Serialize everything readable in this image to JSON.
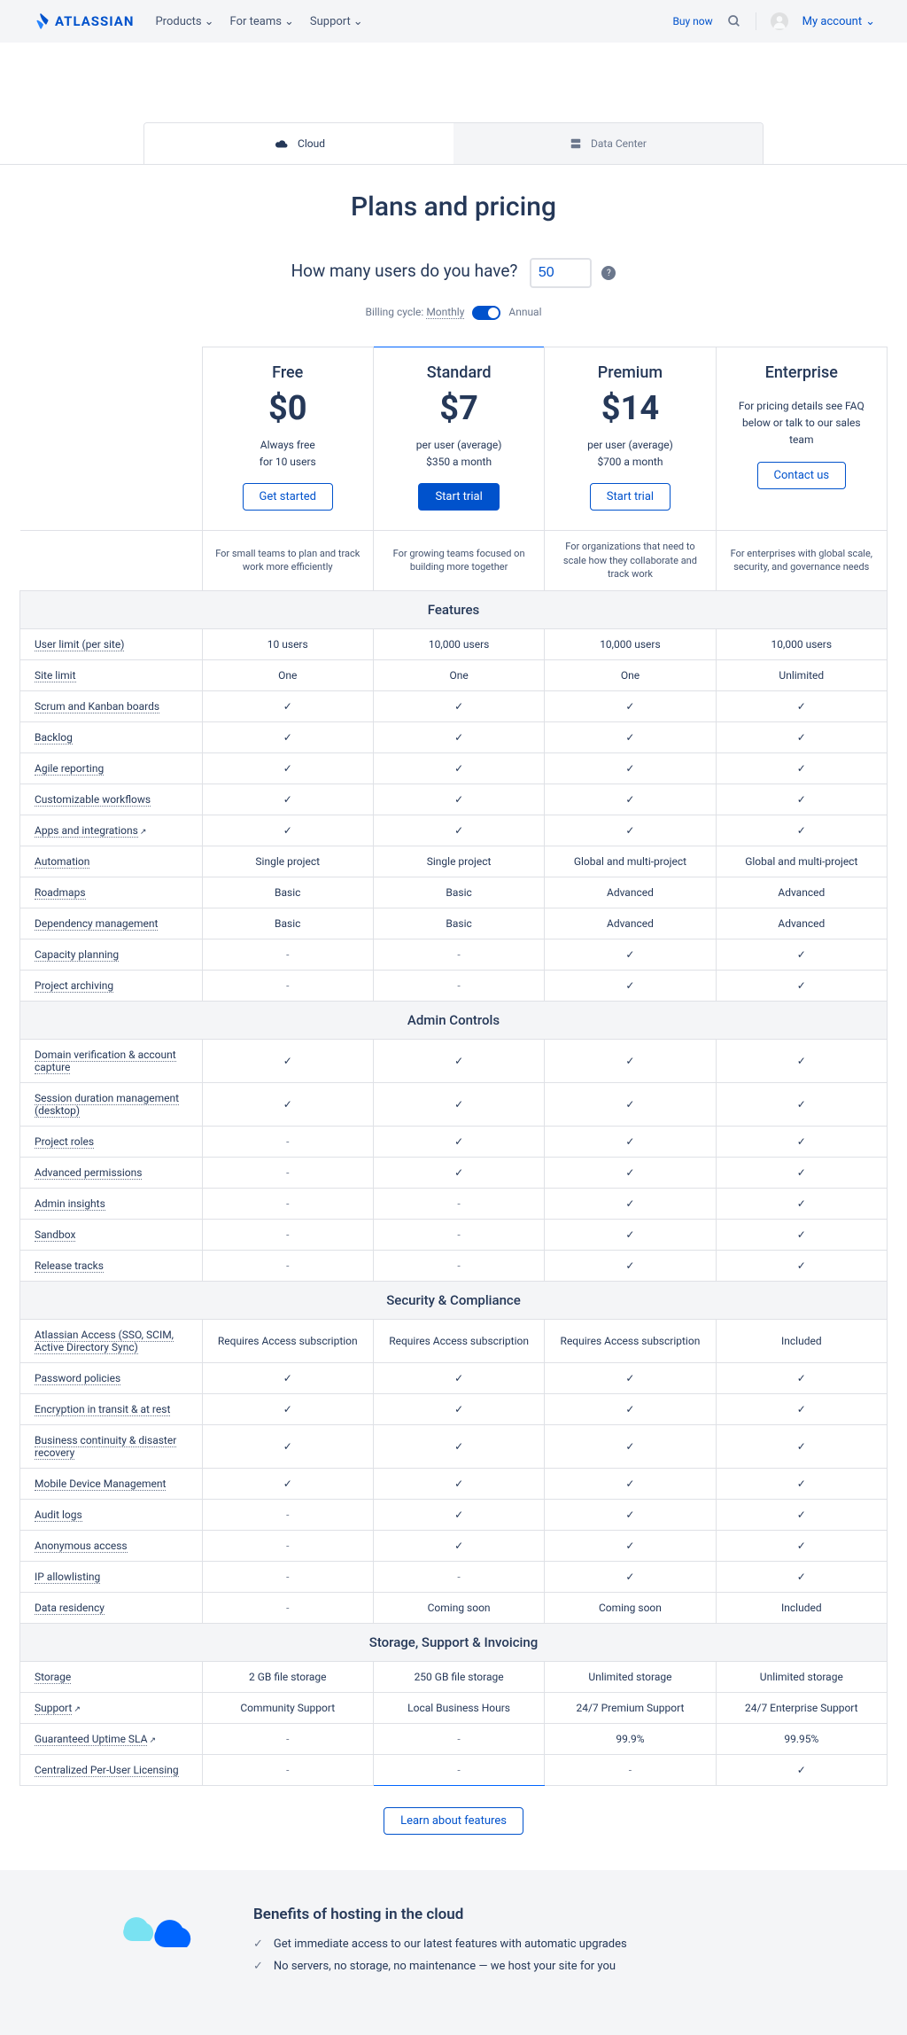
{
  "header": {
    "brand": "ATLASSIAN",
    "nav": [
      "Products",
      "For teams",
      "Support"
    ],
    "buy": "Buy now",
    "account": "My account"
  },
  "tabs": {
    "cloud": "Cloud",
    "dc": "Data Center"
  },
  "title": "Plans and pricing",
  "users": {
    "label": "How many users do you have?",
    "value": "50"
  },
  "billing": {
    "label": "Billing cycle:",
    "monthly": "Monthly",
    "annual": "Annual"
  },
  "plans": {
    "free": {
      "name": "Free",
      "price": "$0",
      "sub1": "Always free",
      "sub2": "for 10 users",
      "cta": "Get started",
      "desc": "For small teams to plan and track work more efficiently"
    },
    "standard": {
      "name": "Standard",
      "price": "$7",
      "sub1": "per user (average)",
      "sub2": "$350 a month",
      "cta": "Start trial",
      "desc": "For growing teams focused on building more together"
    },
    "premium": {
      "name": "Premium",
      "price": "$14",
      "sub1": "per user (average)",
      "sub2": "$700 a month",
      "cta": "Start trial",
      "desc": "For organizations that need to scale how they collaborate and track work"
    },
    "enterprise": {
      "name": "Enterprise",
      "note": "For pricing details see FAQ below or talk to our sales team",
      "cta": "Contact us",
      "desc": "For enterprises with global scale, security, and governance needs"
    }
  },
  "sections": {
    "features": "Features",
    "admin": "Admin Controls",
    "security": "Security & Compliance",
    "storage": "Storage, Support & Invoicing"
  },
  "rows": {
    "features": [
      {
        "l": "User limit (per site)",
        "d": true,
        "v": [
          "10 users",
          "10,000 users",
          "10,000 users",
          "10,000 users"
        ]
      },
      {
        "l": "Site limit",
        "d": true,
        "v": [
          "One",
          "One",
          "One",
          "Unlimited"
        ]
      },
      {
        "l": "Scrum and Kanban boards",
        "d": true,
        "v": [
          "✓",
          "✓",
          "✓",
          "✓"
        ]
      },
      {
        "l": "Backlog",
        "d": true,
        "v": [
          "✓",
          "✓",
          "✓",
          "✓"
        ]
      },
      {
        "l": "Agile reporting",
        "d": true,
        "v": [
          "✓",
          "✓",
          "✓",
          "✓"
        ]
      },
      {
        "l": "Customizable workflows",
        "d": true,
        "v": [
          "✓",
          "✓",
          "✓",
          "✓"
        ]
      },
      {
        "l": "Apps and integrations",
        "d": true,
        "ext": true,
        "v": [
          "✓",
          "✓",
          "✓",
          "✓"
        ]
      },
      {
        "l": "Automation",
        "d": true,
        "v": [
          "Single project",
          "Single project",
          "Global and multi-project",
          "Global and multi-project"
        ]
      },
      {
        "l": "Roadmaps",
        "d": true,
        "v": [
          "Basic",
          "Basic",
          "Advanced",
          "Advanced"
        ]
      },
      {
        "l": "Dependency management",
        "d": true,
        "v": [
          "Basic",
          "Basic",
          "Advanced",
          "Advanced"
        ]
      },
      {
        "l": "Capacity planning",
        "d": true,
        "v": [
          "-",
          "-",
          "✓",
          "✓"
        ]
      },
      {
        "l": "Project archiving",
        "d": true,
        "v": [
          "-",
          "-",
          "✓",
          "✓"
        ]
      }
    ],
    "admin": [
      {
        "l": "Domain verification & account capture",
        "d": true,
        "v": [
          "✓",
          "✓",
          "✓",
          "✓"
        ]
      },
      {
        "l": "Session duration management (desktop)",
        "d": true,
        "v": [
          "✓",
          "✓",
          "✓",
          "✓"
        ]
      },
      {
        "l": "Project roles",
        "d": true,
        "v": [
          "-",
          "✓",
          "✓",
          "✓"
        ]
      },
      {
        "l": "Advanced permissions",
        "d": true,
        "v": [
          "-",
          "✓",
          "✓",
          "✓"
        ]
      },
      {
        "l": "Admin insights",
        "d": true,
        "v": [
          "-",
          "-",
          "✓",
          "✓"
        ]
      },
      {
        "l": "Sandbox",
        "d": true,
        "v": [
          "-",
          "-",
          "✓",
          "✓"
        ]
      },
      {
        "l": "Release tracks",
        "d": true,
        "v": [
          "-",
          "-",
          "✓",
          "✓"
        ]
      }
    ],
    "security": [
      {
        "l": "Atlassian Access (SSO, SCIM, Active Directory Sync)",
        "d": true,
        "v": [
          "Requires Access subscription",
          "Requires Access subscription",
          "Requires Access subscription",
          "Included"
        ]
      },
      {
        "l": "Password policies",
        "d": true,
        "v": [
          "✓",
          "✓",
          "✓",
          "✓"
        ]
      },
      {
        "l": "Encryption in transit & at rest",
        "d": true,
        "v": [
          "✓",
          "✓",
          "✓",
          "✓"
        ]
      },
      {
        "l": "Business continuity & disaster recovery",
        "d": true,
        "v": [
          "✓",
          "✓",
          "✓",
          "✓"
        ]
      },
      {
        "l": "Mobile Device Management",
        "d": true,
        "v": [
          "✓",
          "✓",
          "✓",
          "✓"
        ]
      },
      {
        "l": "Audit logs",
        "d": true,
        "v": [
          "-",
          "✓",
          "✓",
          "✓"
        ]
      },
      {
        "l": "Anonymous access",
        "d": true,
        "v": [
          "-",
          "✓",
          "✓",
          "✓"
        ]
      },
      {
        "l": "IP allowlisting",
        "d": true,
        "v": [
          "-",
          "-",
          "✓",
          "✓"
        ]
      },
      {
        "l": "Data residency",
        "d": true,
        "v": [
          "-",
          "Coming soon",
          "Coming soon",
          "Included"
        ]
      }
    ],
    "storage": [
      {
        "l": "Storage",
        "d": true,
        "v": [
          "2 GB file storage",
          "250 GB file storage",
          "Unlimited storage",
          "Unlimited storage"
        ]
      },
      {
        "l": "Support",
        "d": true,
        "ext": true,
        "v": [
          "Community Support",
          "Local Business Hours",
          "24/7 Premium Support",
          "24/7 Enterprise Support"
        ]
      },
      {
        "l": "Guaranteed Uptime SLA",
        "d": true,
        "ext": true,
        "v": [
          "-",
          "-",
          "99.9%",
          "99.95%"
        ]
      },
      {
        "l": "Centralized Per-User Licensing",
        "d": true,
        "v": [
          "-",
          "-",
          "-",
          "✓"
        ]
      }
    ]
  },
  "learn": "Learn about features",
  "benefits": {
    "title": "Benefits of hosting in the cloud",
    "items": [
      "Get immediate access to our latest features with automatic upgrades",
      "No servers, no storage, no maintenance — we host your site for you"
    ]
  }
}
